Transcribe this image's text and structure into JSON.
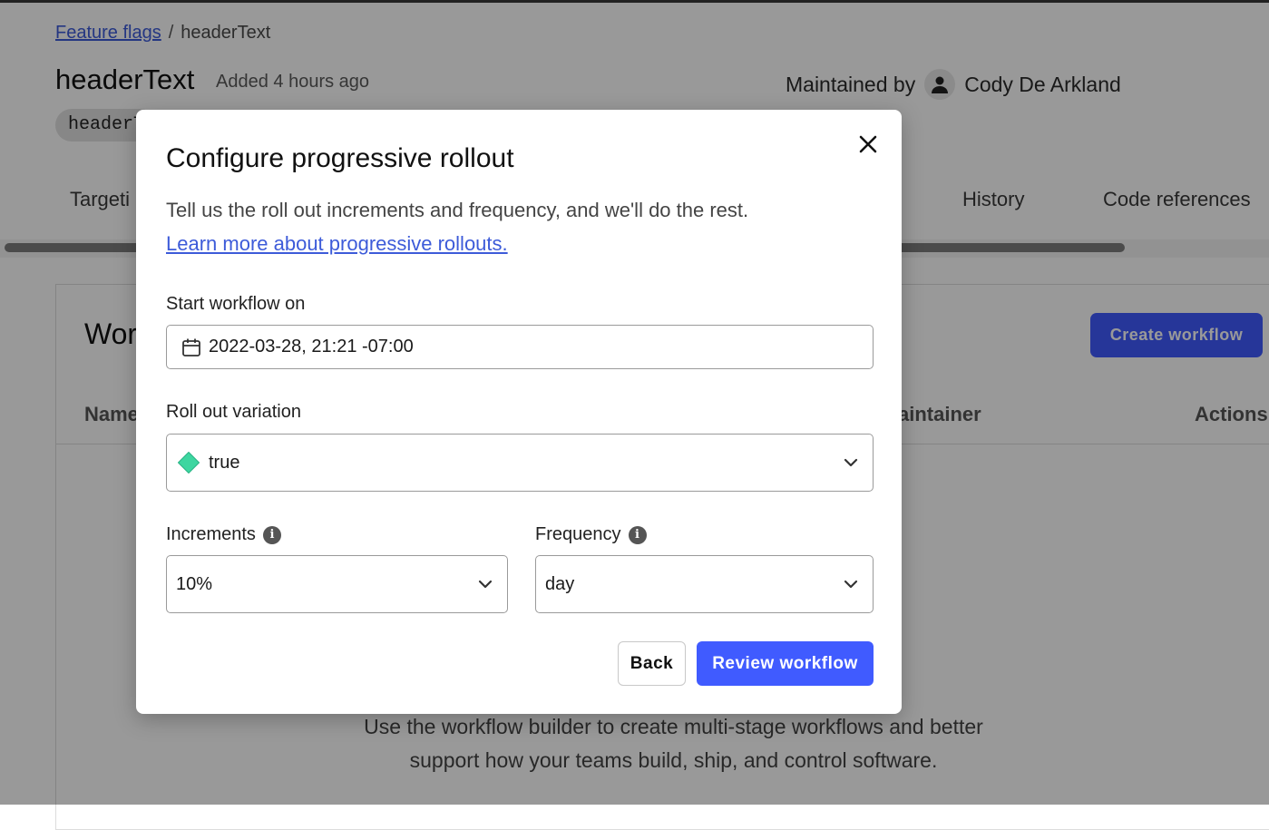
{
  "breadcrumb": {
    "link": "Feature flags",
    "separator": "/",
    "current": "headerText"
  },
  "flag": {
    "name": "headerText",
    "added": "Added 4 hours ago",
    "key_chip": "headerT"
  },
  "maintainer": {
    "label": "Maintained by",
    "name": "Cody De Arkland"
  },
  "tabs": {
    "targeting": "Targeti",
    "history": "History",
    "code_references": "Code references"
  },
  "workflows": {
    "title": "Wor",
    "create_button": "Create workflow",
    "columns": {
      "name": "Name",
      "maintainer": "aintainer",
      "actions": "Actions"
    },
    "empty_text": "Use the workflow builder to create multi-stage workflows and better support how your teams build, ship, and control software."
  },
  "modal": {
    "title": "Configure progressive rollout",
    "description": "Tell us the roll out increments and frequency, and we'll do the rest.",
    "link": "Learn more about progressive rollouts.",
    "start_label": "Start workflow on",
    "start_value": "2022-03-28, 21:21 -07:00",
    "variation_label": "Roll out variation",
    "variation_value": "true",
    "variation_color": "#3dd6a0",
    "increments_label": "Increments",
    "increments_value": "10%",
    "frequency_label": "Frequency",
    "frequency_value": "day",
    "back_button": "Back",
    "review_button": "Review workflow"
  },
  "colors": {
    "primary": "#405bff",
    "link": "#3d5bd9"
  }
}
